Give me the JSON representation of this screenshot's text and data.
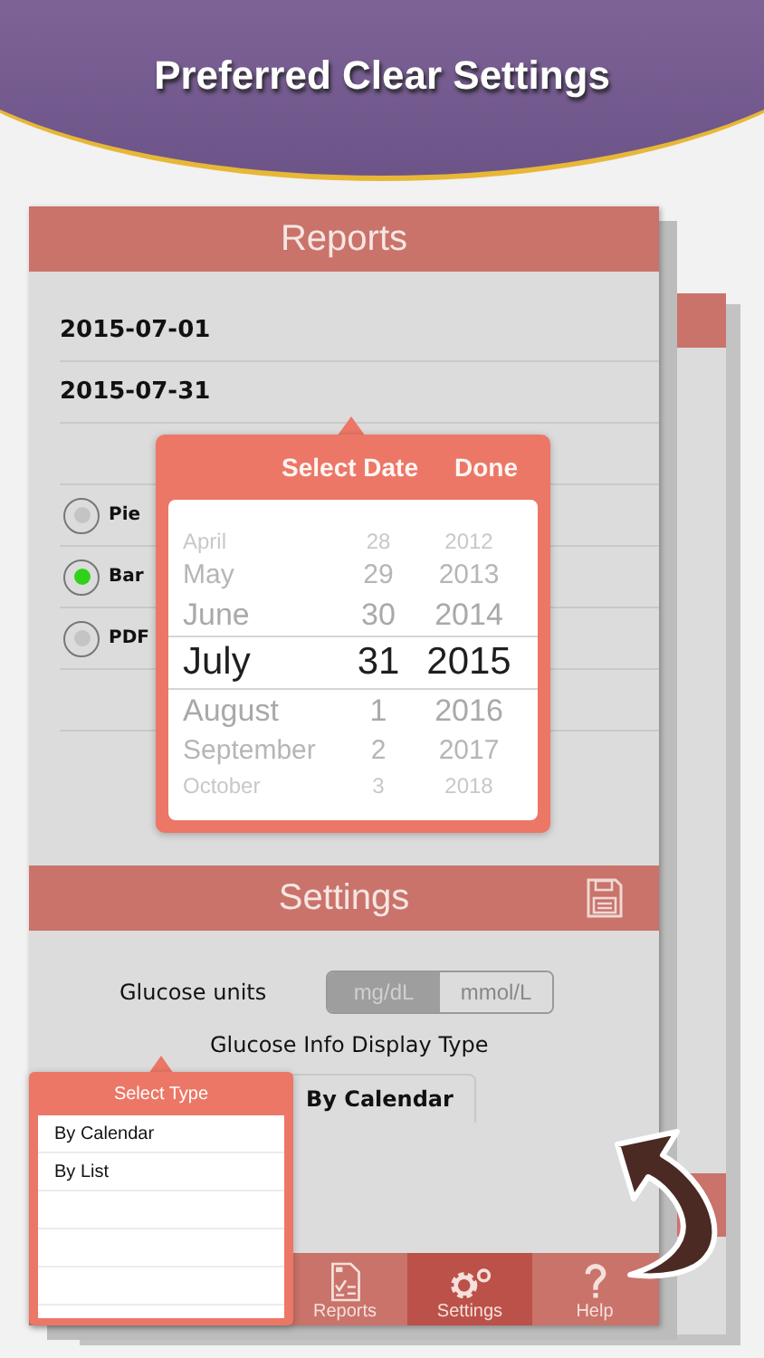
{
  "banner": {
    "title": "Preferred Clear Settings"
  },
  "reports": {
    "title": "Reports",
    "dates": [
      "2015-07-01",
      "2015-07-31"
    ],
    "chart_types": [
      {
        "label": "Pie",
        "selected": false
      },
      {
        "label": "Bar",
        "selected": true
      },
      {
        "label": "PDF",
        "selected": false
      }
    ]
  },
  "date_picker": {
    "title": "Select Date",
    "done": "Done",
    "rows": [
      {
        "month": "April",
        "day": "28",
        "year": "2012",
        "selected": false
      },
      {
        "month": "May",
        "day": "29",
        "year": "2013",
        "selected": false
      },
      {
        "month": "June",
        "day": "30",
        "year": "2014",
        "selected": false
      },
      {
        "month": "July",
        "day": "31",
        "year": "2015",
        "selected": true
      },
      {
        "month": "August",
        "day": "1",
        "year": "2016",
        "selected": false
      },
      {
        "month": "September",
        "day": "2",
        "year": "2017",
        "selected": false
      },
      {
        "month": "October",
        "day": "3",
        "year": "2018",
        "selected": false
      }
    ]
  },
  "settings": {
    "title": "Settings",
    "glucose_label": "Glucose units",
    "units": [
      {
        "label": "mg/dL",
        "selected": true
      },
      {
        "label": "mmol/L",
        "selected": false
      }
    ],
    "display_type_label": "Glucose Info Display Type",
    "display_type_value": "By Calendar"
  },
  "type_popup": {
    "title": "Select Type",
    "options": [
      "By Calendar",
      "By List"
    ]
  },
  "tab_bar": [
    {
      "kind": "reports",
      "label": "Reports",
      "selected": false
    },
    {
      "kind": "settings",
      "label": "Settings",
      "selected": true
    },
    {
      "kind": "help",
      "label": "Help",
      "selected": false
    }
  ]
}
